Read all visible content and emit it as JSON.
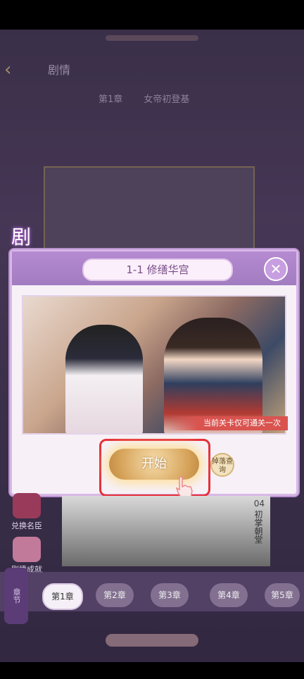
{
  "header": {
    "title": "剧情",
    "back_label": "‹"
  },
  "chapter_bar": {
    "chapter": "第1章",
    "name": "女帝初登基"
  },
  "side_tag": {
    "text": "剧情"
  },
  "dialog": {
    "title": "1-1 修缮华宫",
    "close_label": "✕",
    "notice": "当前关卡仅可通关一次",
    "start_label": "开始",
    "drop_label": "掉落查询"
  },
  "lower_card": {
    "num": "04",
    "title": "初掌朝堂"
  },
  "left_menu": {
    "items": [
      {
        "label": "兑换名臣"
      },
      {
        "label": "剧情成就"
      }
    ]
  },
  "scroll_label": "章节",
  "tabs": [
    {
      "label": "第1章"
    },
    {
      "label": "第2章"
    },
    {
      "label": "第3章"
    },
    {
      "label": "第4章"
    },
    {
      "label": "第5章"
    }
  ],
  "colors": {
    "highlight": "#e6303a",
    "start": "#d6a35a",
    "dialog_header": "#b58ad1"
  }
}
